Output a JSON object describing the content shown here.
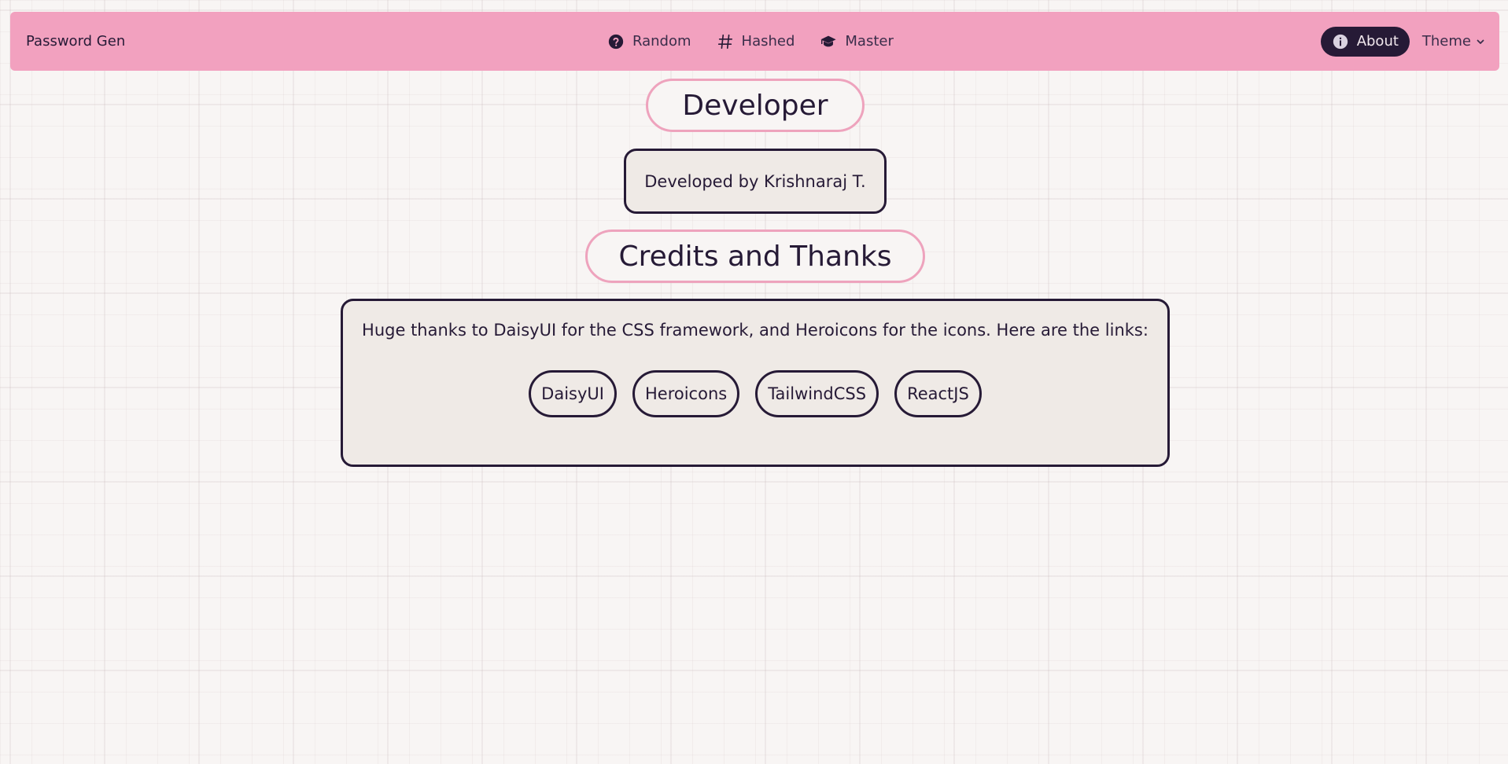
{
  "navbar": {
    "brand": "Password Gen",
    "links": [
      {
        "label": "Random",
        "icon": "question-circle-icon"
      },
      {
        "label": "Hashed",
        "icon": "hashtag-icon"
      },
      {
        "label": "Master",
        "icon": "academic-cap-icon"
      }
    ],
    "about_label": "About",
    "theme_label": "Theme"
  },
  "developer": {
    "title": "Developer",
    "text": "Developed by Krishnaraj T."
  },
  "credits": {
    "title": "Credits and Thanks",
    "text": "Huge thanks to DaisyUI for the CSS framework, and Heroicons for the icons. Here are the links:",
    "links": [
      "DaisyUI",
      "Heroicons",
      "TailwindCSS",
      "ReactJS"
    ]
  },
  "colors": {
    "navbar_bg": "#f2a1bf",
    "dark": "#261a36",
    "pill_border": "#eea3bd",
    "card_bg": "#efeae6"
  }
}
